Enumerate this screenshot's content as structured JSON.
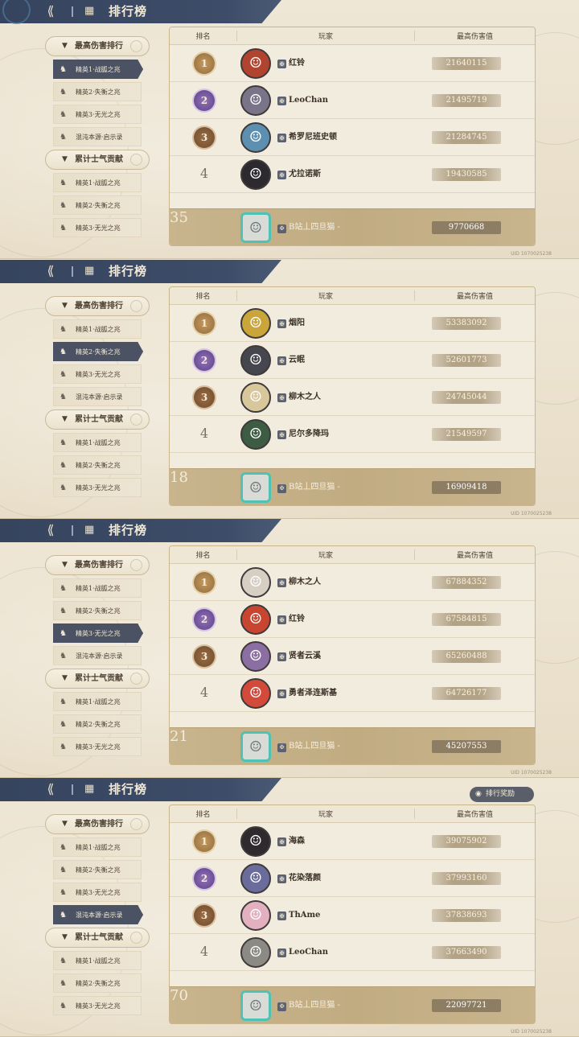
{
  "common": {
    "title": "排行榜",
    "uid": "UID 1070025238",
    "headers": {
      "rank": "排名",
      "player": "玩家",
      "damage": "最高伤害值"
    },
    "reward_button": "排行奖励",
    "sidebar": {
      "cat1": "最高伤害排行",
      "cat2": "累计士气贡献",
      "items_a": [
        "精英1·战胍之兆",
        "精英2·失衡之兆",
        "精英3·无光之兆",
        "混沌本源·启示录"
      ],
      "items_b": [
        "精英1·战胍之兆",
        "精英2·失衡之兆",
        "精英3·无光之兆"
      ]
    },
    "self_name": "B站丄四旦猫 -"
  },
  "panels": [
    {
      "active": 0,
      "rows": [
        {
          "rank": "1",
          "name": "红铃",
          "damage": "21640115"
        },
        {
          "rank": "2",
          "name": "LeoChan",
          "damage": "21495719"
        },
        {
          "rank": "3",
          "name": "希罗尼班史顿",
          "damage": "21284745"
        },
        {
          "rank": "4",
          "name": "尤拉诺斯",
          "damage": "19430585"
        }
      ],
      "self_rank": "35",
      "self_damage": "9770668"
    },
    {
      "active": 1,
      "rows": [
        {
          "rank": "1",
          "name": "烟阳",
          "damage": "53383092"
        },
        {
          "rank": "2",
          "name": "云眠",
          "damage": "52601773"
        },
        {
          "rank": "3",
          "name": "柳木之人",
          "damage": "24745044"
        },
        {
          "rank": "4",
          "name": "尼尔多降玛",
          "damage": "21549597"
        }
      ],
      "self_rank": "18",
      "self_damage": "16909418"
    },
    {
      "active": 2,
      "rows": [
        {
          "rank": "1",
          "name": "柳木之人",
          "damage": "67884352"
        },
        {
          "rank": "2",
          "name": "红铃",
          "damage": "67584815"
        },
        {
          "rank": "3",
          "name": "贤者云溪",
          "damage": "65260488"
        },
        {
          "rank": "4",
          "name": "勇者泽连斯基",
          "damage": "64726177"
        }
      ],
      "self_rank": "21",
      "self_damage": "45207553"
    },
    {
      "active": 3,
      "rows": [
        {
          "rank": "1",
          "name": "海森",
          "damage": "39075902"
        },
        {
          "rank": "2",
          "name": "花染落颜",
          "damage": "37993160"
        },
        {
          "rank": "3",
          "name": "ThAme",
          "damage": "37838693"
        },
        {
          "rank": "4",
          "name": "LeoChan",
          "damage": "37663490"
        }
      ],
      "self_rank": "70",
      "self_damage": "22097721"
    }
  ],
  "colors": {
    "topbar": "#36445e",
    "active_item": "#4b5263",
    "self_row": "#c1ac82",
    "accent_teal": "#4ec2b4"
  },
  "icons": {
    "back": "back-arrow-icon",
    "rank": "rank-icon",
    "wolf": "wolf-icon",
    "guild": "guild-badge-icon",
    "bulb": "bulb-icon"
  }
}
